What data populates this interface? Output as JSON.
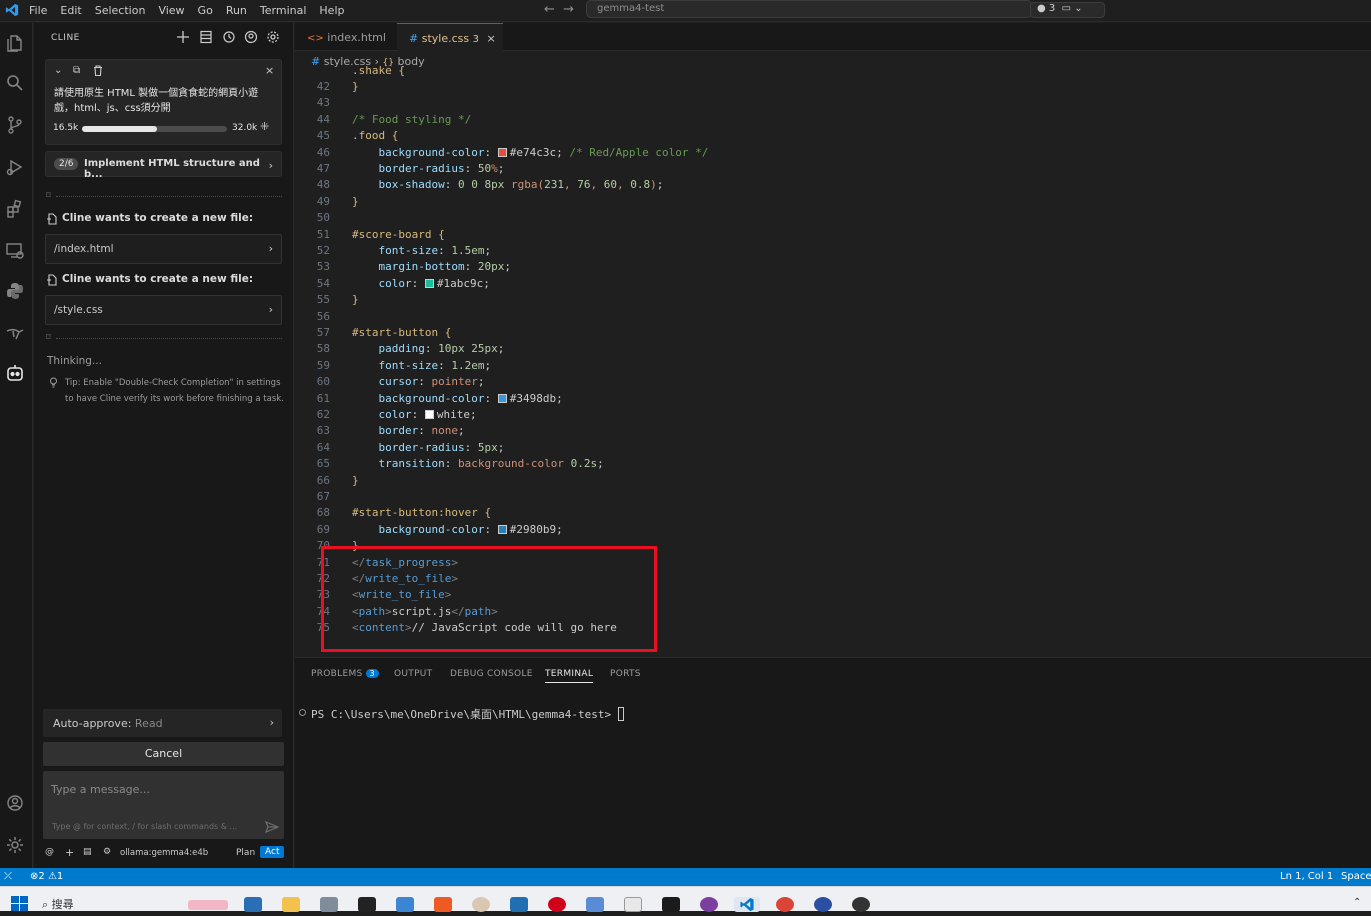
{
  "titlebar": {
    "menu": [
      "File",
      "Edit",
      "Selection",
      "View",
      "Go",
      "Run",
      "Terminal",
      "Help"
    ],
    "search": "gemma4-test",
    "notif_count": "3"
  },
  "cline": {
    "title": "CLINE",
    "task_text": "請使用原生 HTML 製做一個貪食蛇的網頁小遊戲，html、js、css須分開",
    "tokens_used": "16.5k",
    "tokens_max": "32.0k",
    "token_progress": 0.52,
    "step_badge": "2/6",
    "step_label": "Implement HTML structure and b...",
    "wants1": "Cline wants to create a new file:",
    "file1": "/index.html",
    "wants2": "Cline wants to create a new file:",
    "file2": "/style.css",
    "thinking": "Thinking...",
    "tip": "Tip: Enable \"Double-Check Completion\" in settings to have Cline verify its work before finishing a task.",
    "auto_approve_label": "Auto-approve:",
    "auto_approve_value": "Read",
    "cancel": "Cancel",
    "message_placeholder": "Type a message...",
    "message_hint": "Type @ for context, / for slash commands & ...",
    "model": "ollama:gemma4:e4b",
    "plan": "Plan",
    "act": "Act"
  },
  "tabs": [
    {
      "label": "index.html",
      "icon": "<>"
    },
    {
      "label": "style.css",
      "badge": "3",
      "icon": "#"
    }
  ],
  "breadcrumb": {
    "file": "style.css",
    "symbol": "body"
  },
  "code_lines": [
    {
      "n": "42",
      "t": "}"
    },
    {
      "n": "43",
      "t": ""
    },
    {
      "n": "44",
      "t": "/* Food styling */"
    },
    {
      "n": "45",
      "t": ".food {"
    },
    {
      "n": "46",
      "t": "    background-color: #e74c3c; /* Red/Apple color */"
    },
    {
      "n": "47",
      "t": "    border-radius: 50%;"
    },
    {
      "n": "48",
      "t": "    box-shadow: 0 0 8px rgba(231, 76, 60, 0.8);"
    },
    {
      "n": "49",
      "t": "}"
    },
    {
      "n": "50",
      "t": ""
    },
    {
      "n": "51",
      "t": "#score-board {"
    },
    {
      "n": "52",
      "t": "    font-size: 1.5em;"
    },
    {
      "n": "53",
      "t": "    margin-bottom: 20px;"
    },
    {
      "n": "54",
      "t": "    color: #1abc9c;"
    },
    {
      "n": "55",
      "t": "}"
    },
    {
      "n": "56",
      "t": ""
    },
    {
      "n": "57",
      "t": "#start-button {"
    },
    {
      "n": "58",
      "t": "    padding: 10px 25px;"
    },
    {
      "n": "59",
      "t": "    font-size: 1.2em;"
    },
    {
      "n": "60",
      "t": "    cursor: pointer;"
    },
    {
      "n": "61",
      "t": "    background-color: #3498db;"
    },
    {
      "n": "62",
      "t": "    color: white;"
    },
    {
      "n": "63",
      "t": "    border: none;"
    },
    {
      "n": "64",
      "t": "    border-radius: 5px;"
    },
    {
      "n": "65",
      "t": "    transition: background-color 0.2s;"
    },
    {
      "n": "66",
      "t": "}"
    },
    {
      "n": "67",
      "t": ""
    },
    {
      "n": "68",
      "t": "#start-button:hover {"
    },
    {
      "n": "69",
      "t": "    background-color: #2980b9;"
    },
    {
      "n": "70",
      "t": "}"
    },
    {
      "n": "71",
      "t": "</task_progress>"
    },
    {
      "n": "72",
      "t": "</write_to_file>"
    },
    {
      "n": "73",
      "t": "<write_to_file>"
    },
    {
      "n": "74",
      "t": "<path>script.js</path>"
    },
    {
      "n": "75",
      "t": "<content>// JavaScript code will go here"
    }
  ],
  "panel": {
    "tabs": [
      "PROBLEMS",
      "OUTPUT",
      "DEBUG CONSOLE",
      "TERMINAL",
      "PORTS"
    ],
    "problems_count": "3",
    "terminal_line": "PS C:\\Users\\me\\OneDrive\\桌面\\HTML\\gemma4-test> "
  },
  "status": {
    "errors": "2",
    "warnings": "1",
    "position": "Ln 1, Col 1",
    "spaces": "Spaces"
  },
  "taskbar": {
    "search": "搜尋"
  },
  "colors": {
    "accent": "#0078d4",
    "status_bar": "#007acc",
    "highlight_box": "#e81123"
  }
}
